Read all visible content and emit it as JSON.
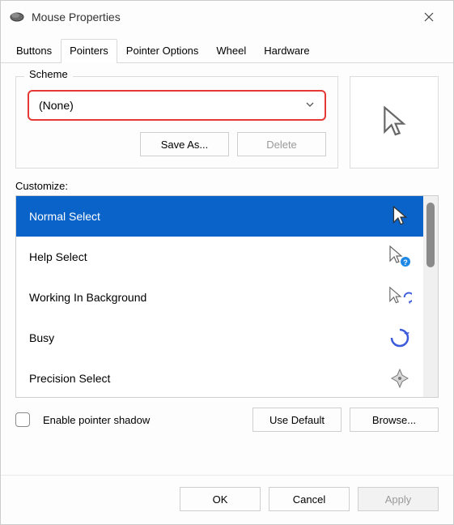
{
  "window": {
    "title": "Mouse Properties"
  },
  "tabs": {
    "items": [
      "Buttons",
      "Pointers",
      "Pointer Options",
      "Wheel",
      "Hardware"
    ],
    "active_index": 1
  },
  "scheme": {
    "legend": "Scheme",
    "selected": "(None)",
    "save_as_label": "Save As...",
    "delete_label": "Delete",
    "delete_enabled": false
  },
  "customize": {
    "label": "Customize:",
    "selected_index": 0,
    "items": [
      {
        "label": "Normal Select",
        "icon": "arrow"
      },
      {
        "label": "Help Select",
        "icon": "arrow-question"
      },
      {
        "label": "Working In Background",
        "icon": "arrow-spinner"
      },
      {
        "label": "Busy",
        "icon": "spinner"
      },
      {
        "label": "Precision Select",
        "icon": "crosshair"
      }
    ]
  },
  "options": {
    "enable_pointer_shadow_label": "Enable pointer shadow",
    "enable_pointer_shadow_checked": false,
    "use_default_label": "Use Default",
    "browse_label": "Browse..."
  },
  "dialog_buttons": {
    "ok": "OK",
    "cancel": "Cancel",
    "apply": "Apply",
    "apply_enabled": false
  }
}
